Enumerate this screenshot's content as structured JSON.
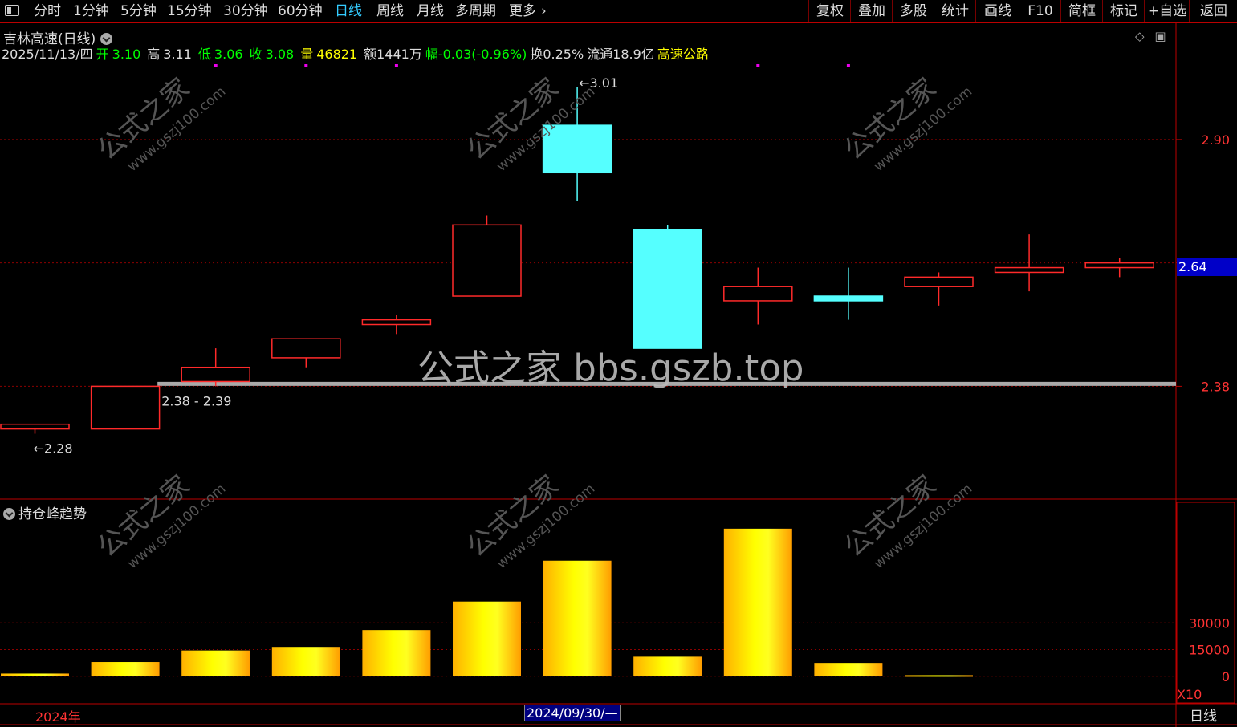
{
  "toolbar": {
    "left": [
      "分时",
      "1分钟",
      "5分钟",
      "15分钟",
      "30分钟",
      "60分钟",
      "日线",
      "周线",
      "月线",
      "多周期",
      "更多"
    ],
    "active": "日线",
    "more_chevron": "chevron-right-icon",
    "right": [
      "复权",
      "叠加",
      "多股",
      "统计",
      "画线",
      "F10",
      "简框",
      "标记",
      "+自选",
      "返回"
    ]
  },
  "stock": {
    "title": "吉林高速(日线)",
    "date": "2025/11/13/四",
    "open_label": "开",
    "open": "3.10",
    "high_label": "高",
    "high": "3.11",
    "low_label": "低",
    "low": "3.06",
    "close_label": "收",
    "close": "3.08",
    "volume_label": "量",
    "volume": "46821",
    "amount": "额1441万",
    "change": "幅-0.03(-0.96%)",
    "turnover": "换0.25%",
    "float_cap": "流通18.9亿",
    "industry": "高速公路"
  },
  "watermark": {
    "center": "公式之家 bbs.gszb.top",
    "tile_cn": "公式之家",
    "tile_url": "www.gszj100.com"
  },
  "price_tag": "2.64",
  "sub_indicator": {
    "title": "持仓峰趋势",
    "multiplier": "X10"
  },
  "bottom": {
    "year_label": "2024年",
    "selected_date": "2024/09/30/—",
    "period": "日线"
  },
  "colors": {
    "up": "#ff2a2a",
    "down": "#55ffff",
    "volume_bar": "#ffee00",
    "support_line": "#aaaaaa",
    "grid": "#8b0000",
    "axis_text": "#ff3333"
  },
  "chart_data": [
    {
      "type": "candlestick",
      "title": "吉林高速(日线)",
      "categories": [
        "1",
        "2",
        "3",
        "4",
        "5",
        "6",
        "7",
        "8",
        "9",
        "10",
        "11",
        "12",
        "13"
      ],
      "candles": [
        {
          "open": 2.29,
          "high": 2.3,
          "low": 2.28,
          "close": 2.3
        },
        {
          "open": 2.29,
          "high": 2.38,
          "low": 2.29,
          "close": 2.38
        },
        {
          "open": 2.39,
          "high": 2.46,
          "low": 2.38,
          "close": 2.42
        },
        {
          "open": 2.44,
          "high": 2.48,
          "low": 2.42,
          "close": 2.48
        },
        {
          "open": 2.51,
          "high": 2.53,
          "low": 2.49,
          "close": 2.52
        },
        {
          "open": 2.57,
          "high": 2.74,
          "low": 2.57,
          "close": 2.72
        },
        {
          "open": 2.93,
          "high": 3.01,
          "low": 2.77,
          "close": 2.83
        },
        {
          "open": 2.71,
          "high": 2.72,
          "low": 2.46,
          "close": 2.46
        },
        {
          "open": 2.56,
          "high": 2.63,
          "low": 2.51,
          "close": 2.59
        },
        {
          "open": 2.57,
          "high": 2.63,
          "low": 2.52,
          "close": 2.56
        },
        {
          "open": 2.59,
          "high": 2.62,
          "low": 2.55,
          "close": 2.61
        },
        {
          "open": 2.62,
          "high": 2.7,
          "low": 2.58,
          "close": 2.63
        },
        {
          "open": 2.63,
          "high": 2.65,
          "low": 2.61,
          "close": 2.64
        }
      ],
      "y_ticks": [
        "2.90",
        "2.64",
        "2.38"
      ],
      "ylim": [
        2.22,
        3.03
      ],
      "annotations": [
        {
          "label": "←2.28",
          "candle": 0
        },
        {
          "label": "←3.01",
          "candle": 6
        },
        {
          "label": "2.38 - 2.39",
          "candle": 2
        }
      ],
      "support_line": 2.38,
      "marker_dots_on_candles": [
        2,
        3,
        4,
        8,
        9
      ],
      "grid": true
    },
    {
      "type": "bar",
      "title": "持仓峰趋势",
      "categories": [
        "1",
        "2",
        "3",
        "4",
        "5",
        "6",
        "7",
        "8",
        "9",
        "10",
        "11",
        "12",
        "13"
      ],
      "values": [
        1500,
        8000,
        14500,
        16500,
        26000,
        42000,
        65000,
        11000,
        83000,
        7500,
        600,
        0,
        0
      ],
      "y_ticks": [
        "30000",
        "15000",
        "0"
      ],
      "ylim": [
        -15000,
        87000
      ],
      "multiplier_label": "X10",
      "grid": true
    }
  ]
}
